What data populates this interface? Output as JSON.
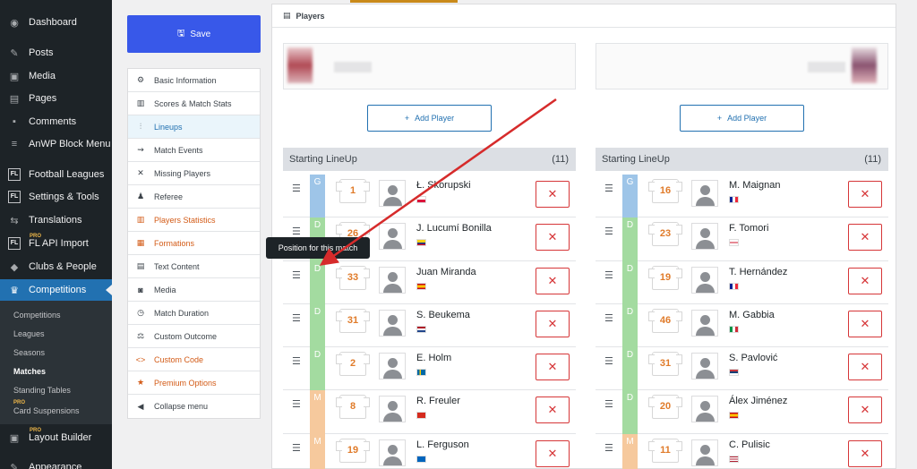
{
  "wp_menu": {
    "items": [
      {
        "label": "Dashboard",
        "icon": "dashboard-icon",
        "glyph": "◉"
      },
      {
        "label": "Posts",
        "icon": "pin-icon",
        "glyph": "✎"
      },
      {
        "label": "Media",
        "icon": "media-icon",
        "glyph": "▣"
      },
      {
        "label": "Pages",
        "icon": "pages-icon",
        "glyph": "▤"
      },
      {
        "label": "Comments",
        "icon": "comments-icon",
        "glyph": "▪"
      },
      {
        "label": "AnWP Block Menu",
        "icon": "menu-icon",
        "glyph": "≡"
      },
      {
        "label": "Football Leagues",
        "icon": "fl-icon",
        "glyph": "FL"
      },
      {
        "label": "Settings & Tools",
        "icon": "fl-icon",
        "glyph": "FL"
      },
      {
        "label": "Translations",
        "icon": "translations-icon",
        "glyph": "⇆"
      },
      {
        "label": "FL API Import",
        "icon": "import-icon",
        "glyph": "FL",
        "pro": "PRO"
      },
      {
        "label": "Clubs & People",
        "icon": "shield-icon",
        "glyph": "◆"
      },
      {
        "label": "Competitions",
        "icon": "trophy-icon",
        "glyph": "♛"
      }
    ],
    "submenu": [
      "Competitions",
      "Leagues",
      "Seasons",
      "Matches",
      "Standing Tables",
      "Card Suspensions"
    ],
    "submenu_pro": "PRO",
    "layout_builder": {
      "label": "Layout Builder",
      "pro": "PRO"
    },
    "appearance": "Appearance"
  },
  "editor": {
    "save_label": "Save",
    "menu": [
      {
        "label": "Basic Information",
        "icon": "gear-icon",
        "glyph": "⚙"
      },
      {
        "label": "Scores & Match Stats",
        "icon": "chart-icon",
        "glyph": "▥"
      },
      {
        "label": "Lineups",
        "icon": "lineups-icon",
        "glyph": "⫶"
      },
      {
        "label": "Match Events",
        "icon": "events-icon",
        "glyph": "⇝"
      },
      {
        "label": "Missing Players",
        "icon": "close-icon",
        "glyph": "✕"
      },
      {
        "label": "Referee",
        "icon": "users-icon",
        "glyph": "👥"
      },
      {
        "label": "Players Statistics",
        "icon": "stats-icon",
        "glyph": "▥"
      },
      {
        "label": "Formations",
        "icon": "formations-icon",
        "glyph": "▦"
      },
      {
        "label": "Text Content",
        "icon": "text-icon",
        "glyph": "▤"
      },
      {
        "label": "Media",
        "icon": "camera-icon",
        "glyph": "◙"
      },
      {
        "label": "Match Duration",
        "icon": "stopwatch-icon",
        "glyph": "◷"
      },
      {
        "label": "Custom Outcome",
        "icon": "scale-icon",
        "glyph": "⚖"
      },
      {
        "label": "Custom Code",
        "icon": "code-icon",
        "glyph": "<>"
      },
      {
        "label": "Premium Options",
        "icon": "star-icon",
        "glyph": "★"
      },
      {
        "label": "Collapse menu",
        "icon": "collapse-icon",
        "glyph": "◀"
      }
    ]
  },
  "players": {
    "title": "Players",
    "add_player_label": "Add Player",
    "tooltip": "Position for this match",
    "colors": {
      "goalkeeper": "#9ec5e8",
      "defender": "#a3dba0",
      "midfielder": "#f6c99d",
      "remove": "#d63638",
      "accent": "#2271b1"
    },
    "teams": [
      {
        "lineup_title": "Starting LineUp",
        "count": "(11)",
        "players": [
          {
            "pos": "G",
            "number": "1",
            "name": "Ł. Skorupski",
            "flag": "poland"
          },
          {
            "pos": "D",
            "number": "26",
            "name": "J. Lucumí Bonilla",
            "flag": "colombia"
          },
          {
            "pos": "D",
            "number": "33",
            "name": "Juan Miranda",
            "flag": "spain"
          },
          {
            "pos": "D",
            "number": "31",
            "name": "S. Beukema",
            "flag": "netherlands"
          },
          {
            "pos": "D",
            "number": "2",
            "name": "E. Holm",
            "flag": "sweden"
          },
          {
            "pos": "M",
            "number": "8",
            "name": "R. Freuler",
            "flag": "switzerland"
          },
          {
            "pos": "M",
            "number": "19",
            "name": "L. Ferguson",
            "flag": "scotland"
          }
        ]
      },
      {
        "lineup_title": "Starting LineUp",
        "count": "(11)",
        "players": [
          {
            "pos": "G",
            "number": "16",
            "name": "M. Maignan",
            "flag": "france"
          },
          {
            "pos": "D",
            "number": "23",
            "name": "F. Tomori",
            "flag": "england"
          },
          {
            "pos": "D",
            "number": "19",
            "name": "T. Hernández",
            "flag": "france"
          },
          {
            "pos": "D",
            "number": "46",
            "name": "M. Gabbia",
            "flag": "italy"
          },
          {
            "pos": "D",
            "number": "31",
            "name": "S. Pavlović",
            "flag": "serbia"
          },
          {
            "pos": "D",
            "number": "20",
            "name": "Álex Jiménez",
            "flag": "spain"
          },
          {
            "pos": "M",
            "number": "11",
            "name": "C. Pulisic",
            "flag": "usa"
          }
        ]
      }
    ]
  }
}
